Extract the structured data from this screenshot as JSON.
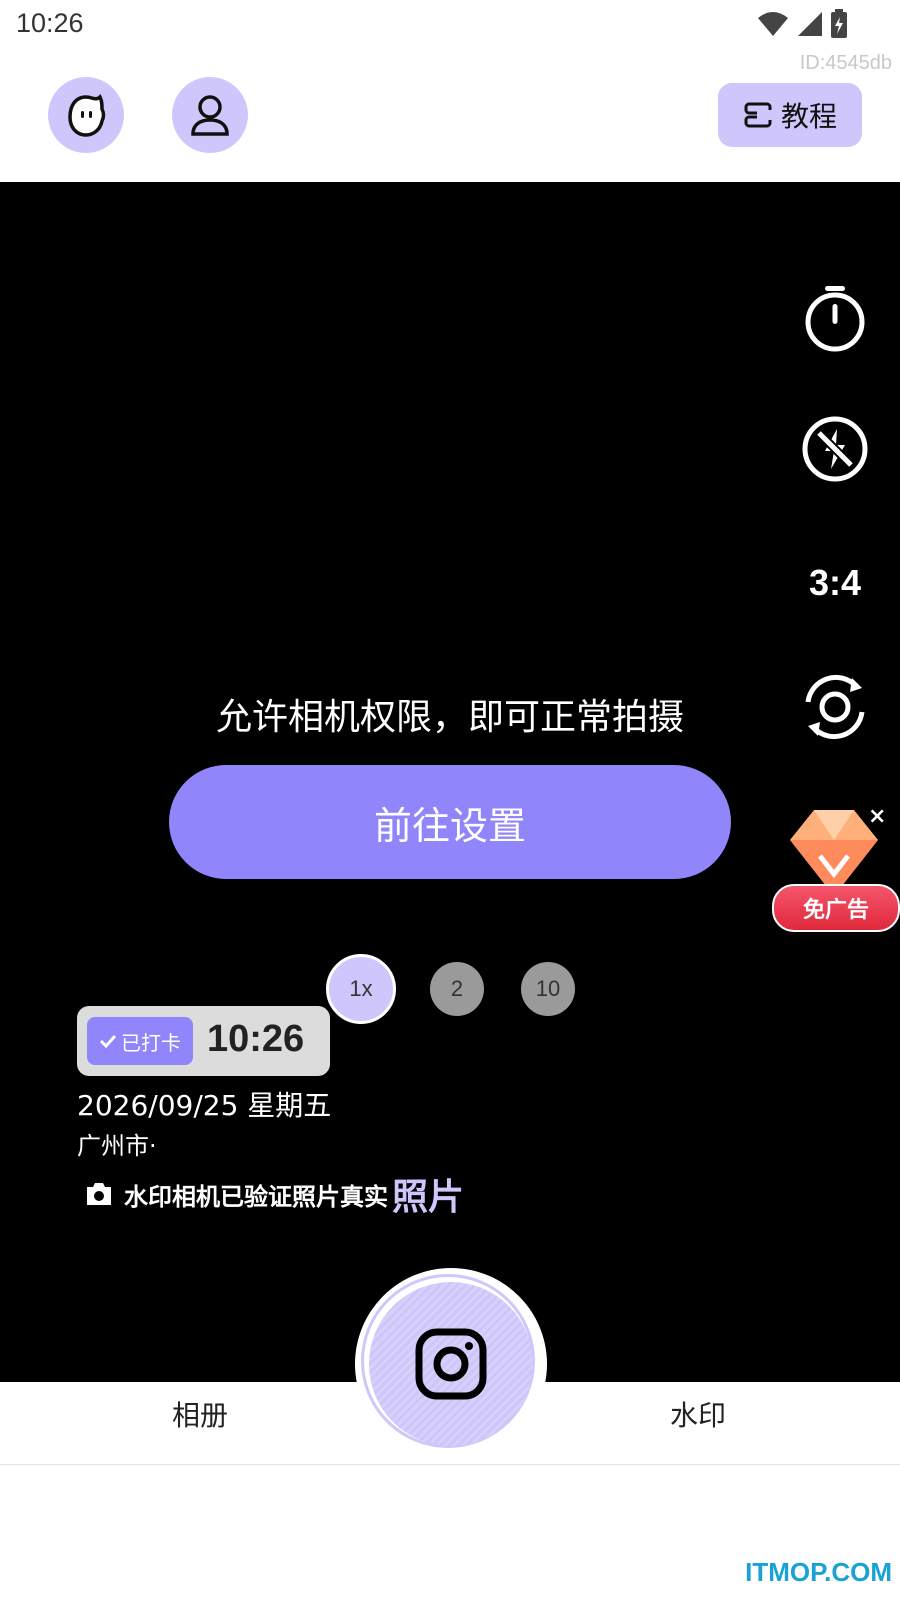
{
  "status_bar": {
    "time": "10:26",
    "icons": [
      "wifi-icon",
      "signal-icon",
      "battery-charging-icon"
    ]
  },
  "header": {
    "user_id": "ID:4545db",
    "buttons": [
      {
        "name": "mascot-face-icon"
      },
      {
        "name": "profile-icon"
      }
    ],
    "tutorial_label": "教程"
  },
  "camera": {
    "ratio_label": "3:4",
    "permission_text": "允许相机权限，即可正常拍摄",
    "settings_button_label": "前往设置",
    "zoom_options": [
      "1x",
      "2",
      "10"
    ],
    "ad": {
      "label": "免广告",
      "close_symbol": "×"
    }
  },
  "watermark": {
    "checkin_label": "已打卡",
    "time": "10:26",
    "date": "2026/09/25 星期五",
    "city": "广州市·",
    "verify_text": "水印相机已验证照片真实",
    "verify_suffix": "照片"
  },
  "bottom_nav": {
    "album_label": "相册",
    "watermark_label": "水印"
  },
  "footer_brand": "ITMOP.COM",
  "colors": {
    "accent": "#9185fb",
    "accent_light": "#cfc7fb",
    "viewport": "#000000"
  }
}
